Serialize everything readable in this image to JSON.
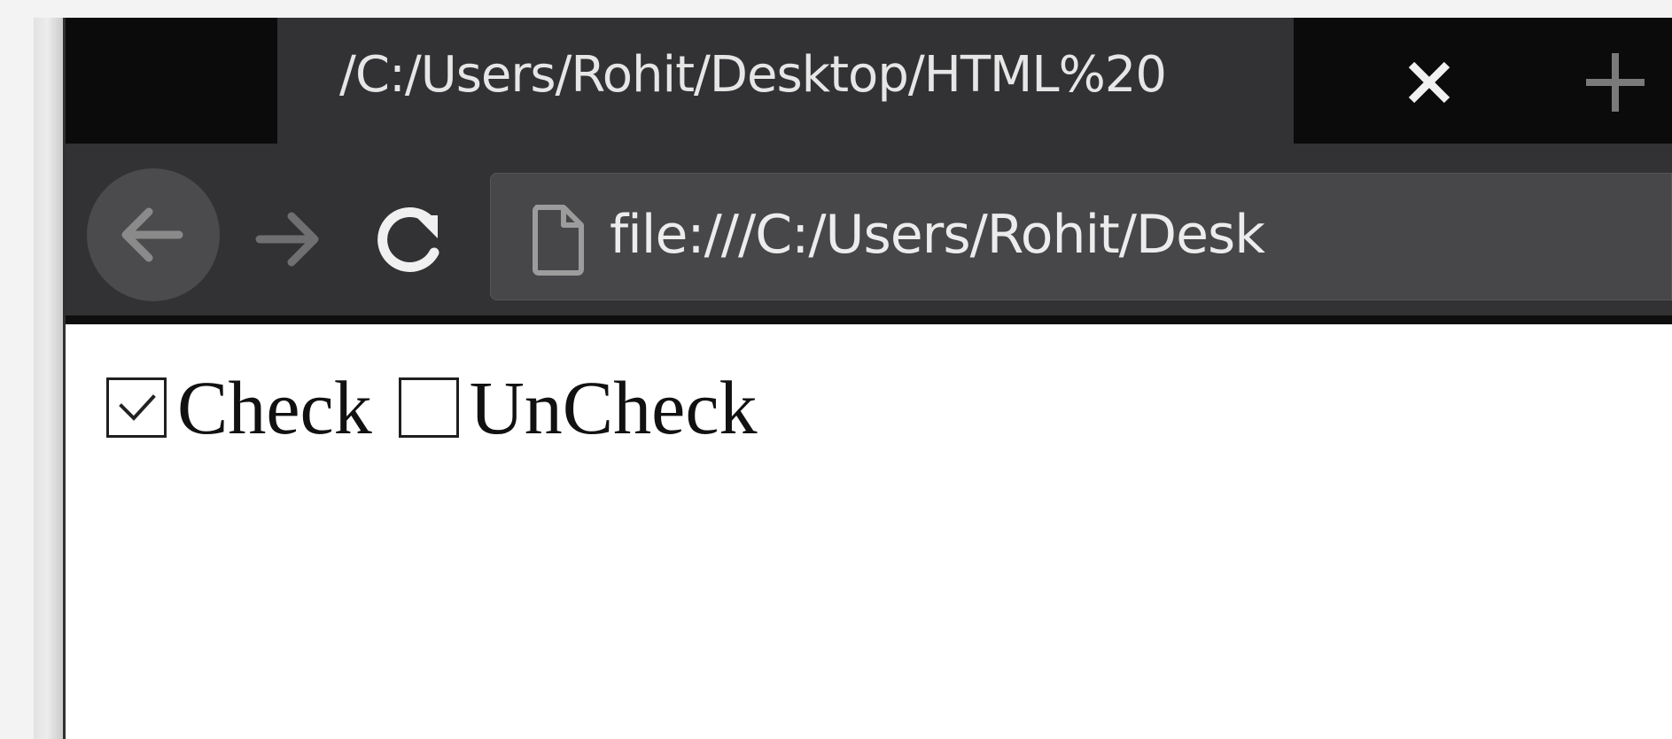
{
  "browser": {
    "tab": {
      "title": "/C:/Users/Rohit/Desktop/HTML%20",
      "close_icon": "close-icon"
    },
    "new_tab_icon": "plus-icon",
    "toolbar": {
      "back_icon": "back-arrow-icon",
      "forward_icon": "forward-arrow-icon",
      "reload_icon": "reload-icon",
      "url_icon": "page-icon",
      "url": "file:///C:/Users/Rohit/Desk"
    }
  },
  "page": {
    "checkboxes": [
      {
        "label": "Check",
        "checked": true
      },
      {
        "label": "UnCheck",
        "checked": false
      }
    ]
  },
  "colors": {
    "tabstrip": "#0b0b0c",
    "toolbar": "#323234",
    "urlbar": "#474749",
    "content": "#ffffff"
  }
}
